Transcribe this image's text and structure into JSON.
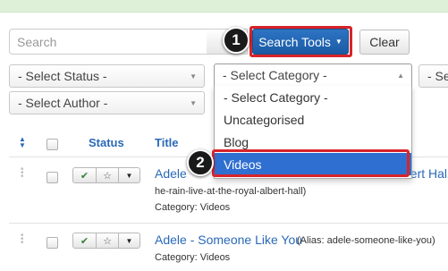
{
  "search": {
    "placeholder": "Search"
  },
  "toolbar": {
    "search_tools_label": "Search Tools",
    "clear_label": "Clear"
  },
  "callouts": {
    "step1": "1",
    "step2": "2"
  },
  "filters": {
    "status": "- Select Status -",
    "category": "- Select Category -",
    "third": "- Se",
    "author": "- Select Author -"
  },
  "category_options": [
    "- Select Category -",
    "Uncategorised",
    "Blog",
    "Videos"
  ],
  "table": {
    "headers": {
      "status": "Status",
      "title": "Title"
    },
    "rows": [
      {
        "title": "Adele",
        "title_tail": "bert Hal",
        "alias_line": "he-rain-live-at-the-royal-albert-hall)",
        "category": "Category: Videos"
      },
      {
        "title": "Adele - Someone Like You",
        "alias": "(Alias: adele-someone-like-you)",
        "category": "Category: Videos"
      }
    ]
  },
  "colors": {
    "primary": "#1b5ba4",
    "highlight": "#d7242b",
    "link": "#2a69b8",
    "selected_option": "#2f6fd1",
    "published_check": "#378137",
    "notice_bg": "#dff0d8"
  },
  "icons": [
    "search-icon",
    "caret-down-icon",
    "chevron-up-icon",
    "sort-icon",
    "drag-handle-icon",
    "check-icon",
    "star-icon"
  ]
}
